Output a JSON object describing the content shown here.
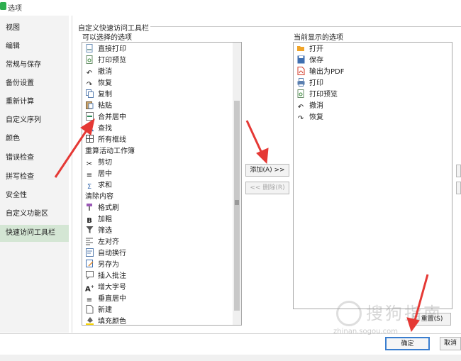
{
  "window": {
    "title": "选项"
  },
  "sidebar": {
    "items": [
      {
        "label": "视图"
      },
      {
        "label": "编辑"
      },
      {
        "label": "常规与保存"
      },
      {
        "label": "备份设置"
      },
      {
        "label": "重新计算"
      },
      {
        "label": "自定义序列"
      },
      {
        "label": "颜色"
      },
      {
        "label": "错误检查"
      },
      {
        "label": "拼写检查"
      },
      {
        "label": "安全性"
      },
      {
        "label": "自定义功能区"
      },
      {
        "label": "快速访问工具栏"
      }
    ],
    "selected": "快速访问工具栏"
  },
  "section": {
    "title": "自定义快速访问工具栏"
  },
  "available": {
    "label": "可以选择的选项",
    "items": [
      {
        "label": "直接打印",
        "icon": "print-direct-icon"
      },
      {
        "label": "打印预览",
        "icon": "print-preview-icon"
      },
      {
        "label": "撤消",
        "icon": "undo-icon"
      },
      {
        "label": "恢复",
        "icon": "redo-icon"
      },
      {
        "label": "复制",
        "icon": "copy-icon"
      },
      {
        "label": "粘贴",
        "icon": "paste-icon"
      },
      {
        "label": "合并居中",
        "icon": "merge-center-icon"
      },
      {
        "label": "查找",
        "icon": "find-icon"
      },
      {
        "label": "所有框线",
        "icon": "all-borders-icon"
      },
      {
        "label": "重算活动工作簿",
        "icon": ""
      },
      {
        "label": "剪切",
        "icon": "cut-icon"
      },
      {
        "label": "居中",
        "icon": "align-center-icon"
      },
      {
        "label": "求和",
        "icon": "sum-icon"
      },
      {
        "label": "清除内容",
        "icon": ""
      },
      {
        "label": "格式刷",
        "icon": "format-painter-icon"
      },
      {
        "label": "加粗",
        "icon": "bold-icon"
      },
      {
        "label": "筛选",
        "icon": "filter-icon"
      },
      {
        "label": "左对齐",
        "icon": "align-left-icon"
      },
      {
        "label": "自动换行",
        "icon": "wrap-text-icon"
      },
      {
        "label": "另存为",
        "icon": "save-as-icon"
      },
      {
        "label": "插入批注",
        "icon": "insert-comment-icon"
      },
      {
        "label": "增大字号",
        "icon": "increase-font-icon"
      },
      {
        "label": "垂直居中",
        "icon": "vertical-center-icon"
      },
      {
        "label": "新建",
        "icon": "new-icon"
      },
      {
        "label": "填充颜色",
        "icon": "fill-color-icon"
      }
    ]
  },
  "current": {
    "label": "当前显示的选项",
    "items": [
      {
        "label": "打开",
        "icon": "open-folder-icon"
      },
      {
        "label": "保存",
        "icon": "save-icon"
      },
      {
        "label": "输出为PDF",
        "icon": "pdf-icon"
      },
      {
        "label": "打印",
        "icon": "print-icon"
      },
      {
        "label": "打印预览",
        "icon": "print-preview-icon"
      },
      {
        "label": "撤消",
        "icon": "undo-icon"
      },
      {
        "label": "恢复",
        "icon": "redo-icon"
      }
    ]
  },
  "buttons": {
    "add": "添加(A) >>",
    "remove": "<< 删除(R)",
    "reset": "重置(S)",
    "ok": "确定",
    "cancel": "取消"
  },
  "watermark": {
    "brand": "搜狗指南",
    "url": "zhinan.sogou.com"
  },
  "colors": {
    "accent": "#3a7ecf",
    "selected_nav": "#d4e6d4",
    "arrow": "#e53935",
    "app_icon": "#2eae4f"
  }
}
